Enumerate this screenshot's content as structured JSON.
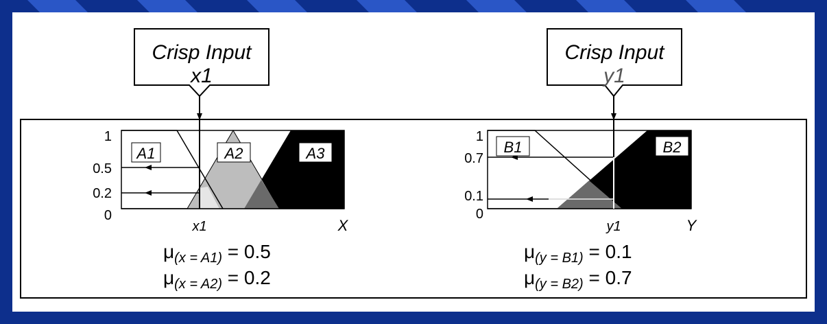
{
  "colors": {
    "background": "#0d2f8c",
    "panel": "#ffffff",
    "light_gray": "#e6e6e6",
    "mid_gray": "#bdbdbd",
    "dark_gray": "#6a6a6a",
    "black": "#000000"
  },
  "left": {
    "crisp_label": "Crisp Input",
    "crisp_var": "x1",
    "axis_var": "X",
    "axis_point": "x1",
    "y_ticks": [
      "1",
      "0.5",
      "0.2",
      "0"
    ],
    "sets": [
      "A1",
      "A2",
      "A3"
    ],
    "equations": [
      {
        "mu": "μ",
        "sub": "(x = A1)",
        "rest": " = 0.5"
      },
      {
        "mu": "μ",
        "sub": "(x = A2)",
        "rest": " = 0.2"
      }
    ]
  },
  "right": {
    "crisp_label": "Crisp Input",
    "crisp_var": "y1",
    "axis_var": "Y",
    "axis_point": "y1",
    "y_ticks": [
      "1",
      "0.7",
      "0.1",
      "0"
    ],
    "sets": [
      "B1",
      "B2"
    ],
    "equations": [
      {
        "mu": "μ",
        "sub": "(y = B1)",
        "rest": " = 0.1"
      },
      {
        "mu": "μ",
        "sub": "(y = B2)",
        "rest": " = 0.7"
      }
    ]
  }
}
